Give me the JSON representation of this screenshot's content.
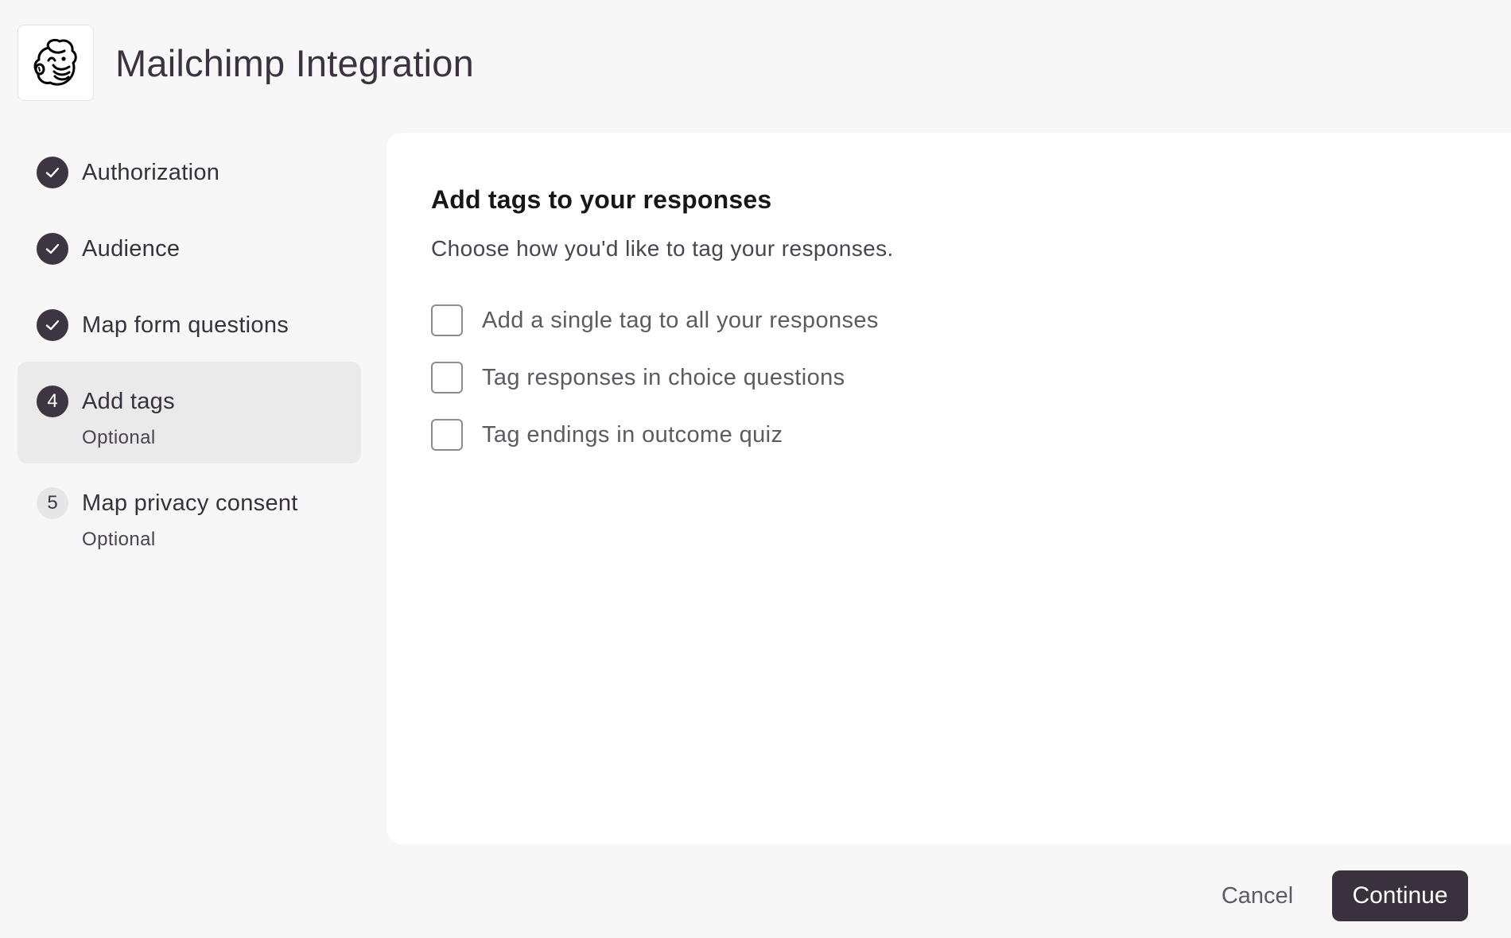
{
  "header": {
    "title": "Mailchimp Integration",
    "logo_icon": "mailchimp-logo"
  },
  "steps": [
    {
      "status": "done",
      "icon": "checkmark-icon",
      "label": "Authorization"
    },
    {
      "status": "done",
      "icon": "checkmark-icon",
      "label": "Audience"
    },
    {
      "status": "done",
      "icon": "checkmark-icon",
      "label": "Map form questions"
    },
    {
      "status": "active",
      "number": "4",
      "label": "Add tags",
      "sublabel": "Optional"
    },
    {
      "status": "pending",
      "number": "5",
      "label": "Map privacy consent",
      "sublabel": "Optional"
    }
  ],
  "panel": {
    "title": "Add tags to your responses",
    "description": "Choose how you'd like to tag your responses.",
    "options": [
      {
        "label": "Add a single tag to all your responses",
        "checked": false
      },
      {
        "label": "Tag responses in choice questions",
        "checked": false
      },
      {
        "label": "Tag endings in outcome quiz",
        "checked": false
      }
    ]
  },
  "footer": {
    "cancel_label": "Cancel",
    "continue_label": "Continue"
  },
  "colors": {
    "background": "#f7f7f7",
    "panel": "#ffffff",
    "primary": "#39313c",
    "active_step_bg": "#eaeaea"
  }
}
